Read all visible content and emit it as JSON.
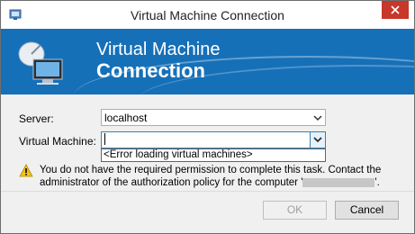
{
  "window": {
    "title": "Virtual Machine Connection"
  },
  "banner": {
    "line1": "Virtual Machine",
    "line2": "Connection"
  },
  "form": {
    "server_label": "Server:",
    "server_value": "localhost",
    "vm_label": "Virtual Machine:",
    "vm_value": "",
    "vm_dropdown_item": "<Error loading virtual machines>"
  },
  "warning": {
    "text_before": "You do not have the required permission to complete this task. Contact the administrator of the authorization policy for the computer '",
    "text_after": "'."
  },
  "buttons": {
    "ok": "OK",
    "cancel": "Cancel"
  },
  "icons": {
    "app": "app-window-icon",
    "close": "close-icon",
    "banner": "satellite-monitor-icon",
    "warning": "warning-triangle-icon",
    "dropdown": "chevron-down-icon"
  },
  "colors": {
    "banner": "#1670b8",
    "close": "#c7372a",
    "warning": "#f2c316"
  }
}
